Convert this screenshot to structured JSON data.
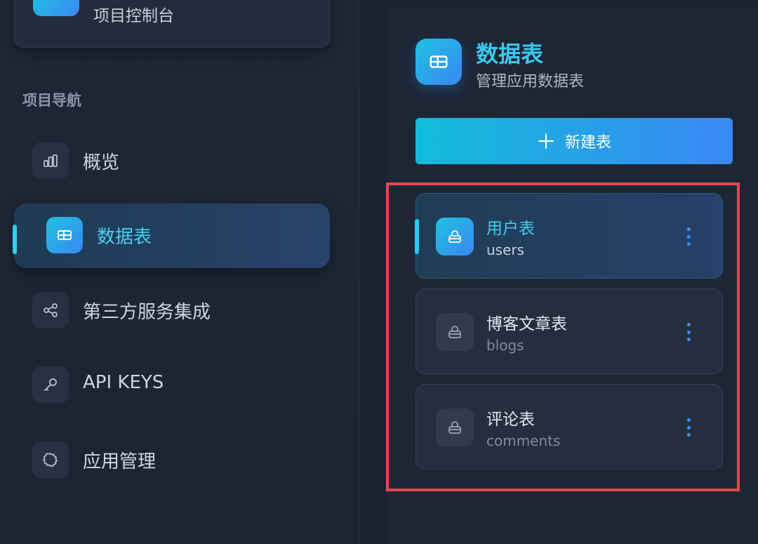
{
  "project": {
    "title": "项目控制台"
  },
  "nav": {
    "heading": "项目导航",
    "items": [
      {
        "label": "概览",
        "icon": "bar-chart-icon"
      },
      {
        "label": "数据表",
        "icon": "table-icon",
        "active": true
      },
      {
        "label": "第三方服务集成",
        "icon": "share-icon"
      },
      {
        "label": "API KEYS",
        "icon": "key-icon"
      },
      {
        "label": "应用管理",
        "icon": "gear-icon"
      }
    ]
  },
  "main": {
    "title": "数据表",
    "subtitle": "管理应用数据表",
    "new_button": "新建表",
    "tables": [
      {
        "name": "用户表",
        "slug": "users",
        "active": true
      },
      {
        "name": "博客文章表",
        "slug": "blogs"
      },
      {
        "name": "评论表",
        "slug": "comments"
      }
    ]
  },
  "colors": {
    "accent": "#38c9ee",
    "accent_gradient_start": "#1ec3e0",
    "accent_gradient_end": "#3a86f3",
    "highlight_frame": "#e4484e",
    "kebab": "#3a8ef5"
  }
}
